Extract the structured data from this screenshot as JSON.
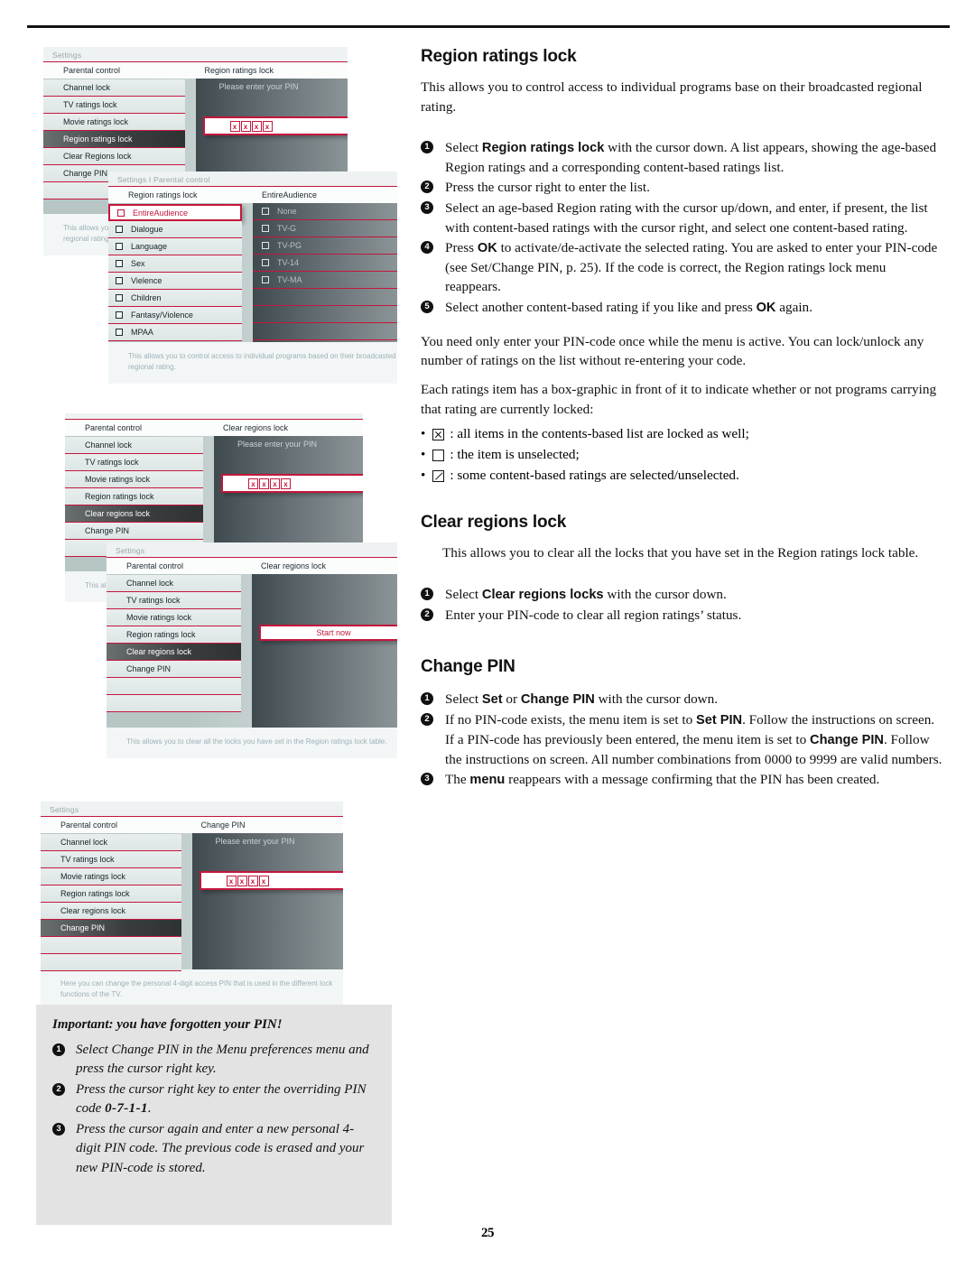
{
  "page": {
    "number": "25"
  },
  "osd": {
    "pin_prompt": "Please enter your PIN",
    "pin_chars": [
      "x",
      "x",
      "x",
      "x"
    ],
    "start_now": "Start now",
    "parental_control_label": "Parental control",
    "breadcrumb_settings": "Settings",
    "breadcrumb_settings_parental": "Settings I Parental control",
    "menu_items": [
      "Channel lock",
      "TV ratings lock",
      "Movie ratings lock",
      "Region ratings lock",
      "Clear regions lock",
      "Change PIN"
    ],
    "shot1": {
      "breadcrumb": "Settings",
      "right_header": "Region ratings lock",
      "items": [
        "Channel lock",
        "TV ratings lock",
        "Movie ratings lock",
        "Region ratings lock",
        "Clear Regions lock",
        "Change PIN"
      ],
      "selected_index": 3,
      "help": "This allows you to control access to individual programs based on their broadcasted regional rating."
    },
    "shot1b": {
      "breadcrumb": "Settings I Parental control",
      "left_header": "Region ratings lock",
      "right_header": "EntireAudience",
      "left_items": [
        "EntireAudience",
        "Dialogue",
        "Language",
        "Sex",
        "Vielence",
        "Children",
        "Fantasy/Violence",
        "MPAA"
      ],
      "left_highlight_index": 0,
      "right_items": [
        "None",
        "TV-G",
        "TV-PG",
        "TV-14",
        "TV-MA"
      ],
      "help": "This allows you to control access to individual programs based on their broadcasted regional rating."
    },
    "shot2": {
      "breadcrumb": "",
      "right_header": "Clear regions lock",
      "items": [
        "Channel lock",
        "TV ratings lock",
        "Movie ratings lock",
        "Region ratings lock",
        "Clear regions lock",
        "Change PIN"
      ],
      "selected_index": 4,
      "help": "This allows you to clear all the locks you have set in the Region ratings lock table."
    },
    "shot2b": {
      "breadcrumb": "Settings",
      "right_header": "Clear regions lock",
      "items": [
        "Channel lock",
        "TV ratings lock",
        "Movie ratings lock",
        "Region ratings lock",
        "Clear regions lock",
        "Change PIN"
      ],
      "selected_index": 4,
      "help": "This allows you to clear all the locks you have set in the Region ratings lock table."
    },
    "shot3": {
      "breadcrumb": "Settings",
      "right_header": "Change PIN",
      "items": [
        "Channel lock",
        "TV ratings lock",
        "Movie ratings lock",
        "Region ratings lock",
        "Clear regions lock",
        "Change PIN"
      ],
      "selected_index": 5,
      "help": "Here you can change the personal 4-digit access PIN that is used in the different lock functions of the TV."
    }
  },
  "sections": {
    "region": {
      "heading": "Region ratings lock",
      "intro": "This allows you to control access to individual programs base on their broadcasted regional rating.",
      "steps": [
        {
          "num": "1",
          "pre": "Select ",
          "bold": "Region ratings lock",
          "post": " with the cursor down. A list appears, showing the age-based Region ratings and a corresponding content-based ratings list."
        },
        {
          "num": "2",
          "pre": "Press the cursor right to enter the list.",
          "bold": "",
          "post": ""
        },
        {
          "num": "3",
          "pre": "Select an age-based Region rating with the cursor up/down, and enter, if present, the list with content-based ratings with the cursor right, and select one content-based rating.",
          "bold": "",
          "post": ""
        },
        {
          "num": "4",
          "pre": "Press ",
          "bold": "OK",
          "post": " to activate/de-activate the selected rating. You are asked to enter your PIN-code (see Set/Change PIN, p. 25). If the code is correct, the Region ratings lock menu reappears."
        },
        {
          "num": "5",
          "pre": "Select another content-based rating if you like and press ",
          "bold": "OK",
          "post": " again."
        }
      ],
      "note1": "You need only enter your PIN-code once while the menu is active. You can lock/unlock any number of ratings on the list without re-entering your code.",
      "note2": "Each ratings item has a box-graphic in front of it to indicate whether or not programs carrying that rating are currently locked:",
      "bullets": [
        {
          "icon": "checkbox-x-icon",
          "text": ": all items in the contents-based list are locked as well;"
        },
        {
          "icon": "checkbox-empty-icon",
          "text": ": the item is unselected;"
        },
        {
          "icon": "checkbox-slash-icon",
          "text": ": some content-based ratings are selected/unselected."
        }
      ]
    },
    "clear": {
      "heading": "Clear regions lock",
      "intro": "This allows you to clear all the locks that you have set in the Region ratings lock table.",
      "steps": [
        {
          "num": "1",
          "pre": "Select ",
          "bold": "Clear regions locks",
          "post": " with the cursor down."
        },
        {
          "num": "2",
          "pre": "Enter your PIN-code to clear all region ratings’ status.",
          "bold": "",
          "post": ""
        }
      ]
    },
    "pin": {
      "heading": "Change PIN",
      "steps": [
        {
          "num": "1",
          "pre": "Select ",
          "bold": "Set",
          "mid": " or ",
          "bold2": "Change PIN",
          "post": " with the cursor down."
        },
        {
          "num": "2",
          "pre": "If no PIN-code exists, the menu item is set to ",
          "bold": "Set PIN",
          "mid": ". Follow the instructions on screen. If a PIN-code has previously been entered, the menu item is set to ",
          "bold2": "Change PIN",
          "post": ". Follow the instructions on screen. All number combinations from 0000 to 9999 are valid numbers."
        },
        {
          "num": "3",
          "pre": "The ",
          "bold": "menu",
          "mid": "",
          "bold2": "",
          "post": " reappears with a message confirming that the PIN has been created."
        }
      ]
    }
  },
  "important": {
    "title": "Important: you have forgotten your PIN!",
    "steps": [
      {
        "num": "1",
        "pre": "Select Change PIN in the Menu preferences menu and press the cursor right key.",
        "code": "",
        "post": ""
      },
      {
        "num": "2",
        "pre": "Press the cursor right key to enter the overriding PIN code ",
        "code": "0-7-1-1",
        "post": "."
      },
      {
        "num": "3",
        "pre": "Press the cursor again and enter a new personal 4-digit PIN code. The previous code is erased and your new PIN-code is stored.",
        "code": "",
        "post": ""
      }
    ]
  }
}
